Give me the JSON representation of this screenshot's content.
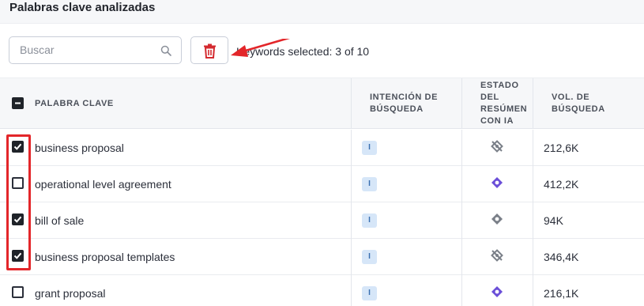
{
  "header": {
    "title": "Palabras clave analizadas"
  },
  "toolbar": {
    "search_placeholder": "Buscar",
    "search_value": "",
    "selection_status": "Keywords selected: 3 of 10"
  },
  "table": {
    "columns": {
      "keyword": "PALABRA CLAVE",
      "intent": [
        "INTENCIÓN DE",
        "BÚSQUEDA"
      ],
      "ai_overview": [
        "ESTADO",
        "DEL",
        "RESÚMEN",
        "CON IA"
      ],
      "volume": [
        "VOL. DE",
        "BÚSQUEDA"
      ]
    },
    "rows": [
      {
        "checked": true,
        "keyword": "business proposal",
        "intent": "I",
        "ai_status": "not-present-icon",
        "volume": "212,6K"
      },
      {
        "checked": false,
        "keyword": "operational level agreement",
        "intent": "I",
        "ai_status": "ai-overview-purple-icon",
        "volume": "412,2K"
      },
      {
        "checked": true,
        "keyword": "bill of sale",
        "intent": "I",
        "ai_status": "ai-overview-gray-icon",
        "volume": "94K"
      },
      {
        "checked": true,
        "keyword": "business proposal templates",
        "intent": "I",
        "ai_status": "not-present-icon",
        "volume": "346,4K"
      },
      {
        "checked": false,
        "keyword": "grant proposal",
        "intent": "I",
        "ai_status": "ai-overview-purple-icon",
        "volume": "216,1K"
      }
    ]
  },
  "colors": {
    "annotation_red": "#e3262a",
    "delete_red": "#d42a2f",
    "ai_purple": "#6b4fd8",
    "ai_gray": "#7a7f88",
    "intent_badge_bg": "#d6e6f8"
  }
}
